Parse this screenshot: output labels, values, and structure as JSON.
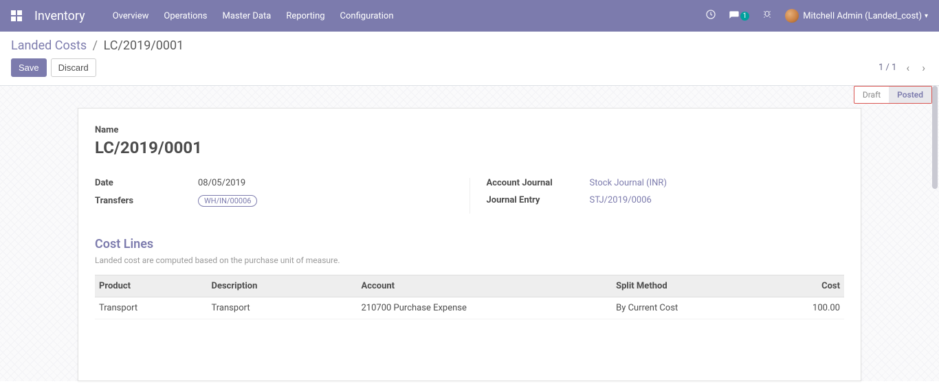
{
  "navbar": {
    "brand": "Inventory",
    "menu": [
      "Overview",
      "Operations",
      "Master Data",
      "Reporting",
      "Configuration"
    ],
    "msg_count": "1",
    "user": "Mitchell Admin (Landed_cost)"
  },
  "breadcrumb": {
    "root": "Landed Costs",
    "current": "LC/2019/0001"
  },
  "actions": {
    "save": "Save",
    "discard": "Discard"
  },
  "pager": {
    "text": "1 / 1"
  },
  "status": {
    "draft": "Draft",
    "posted": "Posted",
    "active": "posted"
  },
  "form": {
    "name_label": "Name",
    "name_value": "LC/2019/0001",
    "date_label": "Date",
    "date_value": "08/05/2019",
    "transfers_label": "Transfers",
    "transfers_value": "WH/IN/00006",
    "journal_label": "Account Journal",
    "journal_value": "Stock Journal (INR)",
    "entry_label": "Journal Entry",
    "entry_value": "STJ/2019/0006"
  },
  "cost_lines": {
    "title": "Cost Lines",
    "note": "Landed cost are computed based on the purchase unit of measure.",
    "headers": {
      "product": "Product",
      "description": "Description",
      "account": "Account",
      "split": "Split Method",
      "cost": "Cost"
    },
    "rows": [
      {
        "product": "Transport",
        "description": "Transport",
        "account": "210700 Purchase Expense",
        "split": "By Current Cost",
        "cost": "100.00"
      }
    ]
  }
}
